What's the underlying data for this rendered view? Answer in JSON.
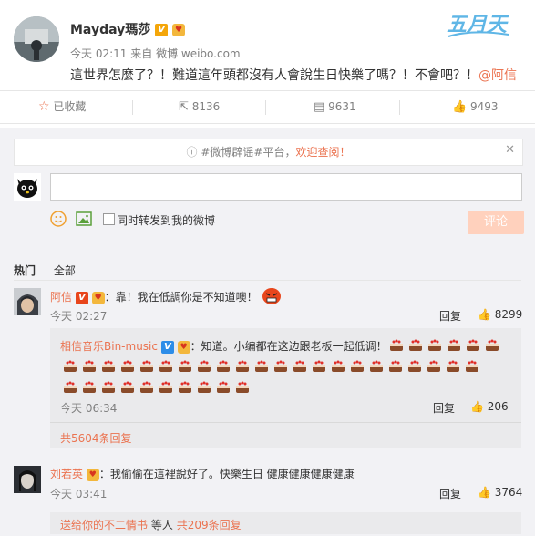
{
  "post": {
    "author": "Mayday瑪莎",
    "time": "今天 02:11",
    "source_prefix": "来自",
    "source": "微博 weibo.com",
    "text": "這世界怎麼了？！難道這年頭都沒有人會說生日快樂了嗎？！不會吧？！",
    "mention": "@阿信",
    "logo_text": "五月天"
  },
  "actions": {
    "favorite": "已收藏",
    "repost": "8136",
    "comment": "9631",
    "like": "9493"
  },
  "notice": {
    "tag": "#微博辟谣#平台",
    "cta": "欢迎查阅！",
    "sep": "，",
    "close": "✕"
  },
  "composer": {
    "forward_label": "同时转发到我的微博",
    "submit": "评论"
  },
  "tabs": {
    "hot": "热门",
    "all": "全部"
  },
  "comments": [
    {
      "name": "阿信",
      "text": "：靠！我在低調你是不知道噢！",
      "time": "今天 02:27",
      "reply": "回复",
      "likes": "8299"
    },
    {
      "name": "刘若英",
      "text": "：我偷偷在這裡說好了。快樂生日 健康健康健康健康",
      "time": "今天 03:41",
      "reply": "回复",
      "likes": "3764"
    }
  ],
  "sub_reply": {
    "name": "相信音乐Bin-music",
    "text": "：知道。小编都在这边跟老板一起低调！",
    "time": "今天 06:34",
    "reply": "回复",
    "likes": "206",
    "more": "共5604条回复"
  },
  "footer": {
    "prefix": "送给你的不二情书",
    "middle": "等人",
    "more": "共209条回复"
  },
  "icons": {
    "favorite": "star-icon",
    "repost": "repost-icon",
    "comment": "comment-icon",
    "like": "thumbs-up-icon"
  },
  "colors": {
    "accent": "#eb7350",
    "link": "#eb7350",
    "submit_bg": "#ffd1bd",
    "panel_bg": "#f2f2f5"
  }
}
